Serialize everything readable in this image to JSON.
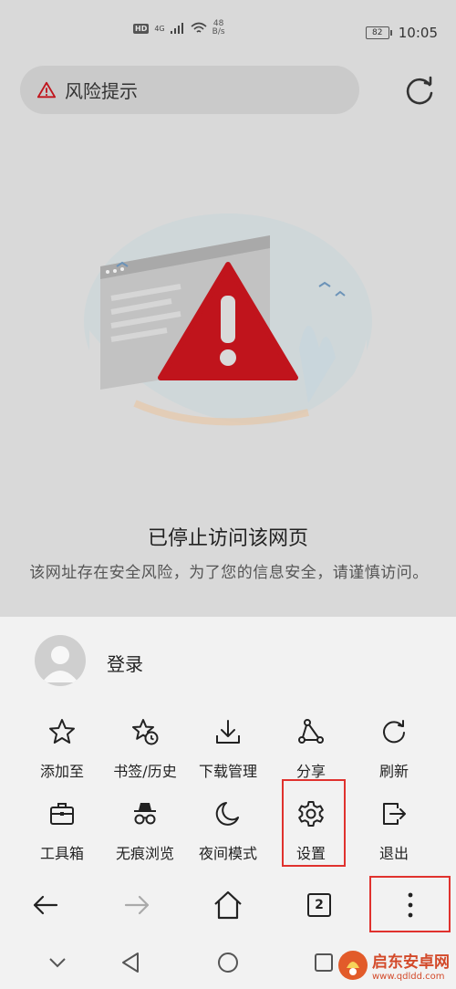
{
  "status_bar": {
    "hd_badge": "HD",
    "network_type": "4G",
    "speed_value": "48",
    "speed_unit": "B/s",
    "battery": "82",
    "time": "10:05"
  },
  "address_bar": {
    "text": "风险提示",
    "warning_icon": "warning-triangle-icon",
    "reload_icon": "reload-icon"
  },
  "error_page": {
    "title": "已停止访问该网页",
    "description": "该网址存在安全风险，为了您的信息安全，请谨慎访问。"
  },
  "menu": {
    "login_label": "登录",
    "items": [
      {
        "label": "添加至",
        "icon": "star-icon"
      },
      {
        "label": "书签/历史",
        "icon": "bookmark-history-icon"
      },
      {
        "label": "下载管理",
        "icon": "download-icon"
      },
      {
        "label": "分享",
        "icon": "share-icon"
      },
      {
        "label": "刷新",
        "icon": "refresh-icon"
      },
      {
        "label": "工具箱",
        "icon": "toolbox-icon"
      },
      {
        "label": "无痕浏览",
        "icon": "incognito-icon"
      },
      {
        "label": "夜间模式",
        "icon": "moon-icon"
      },
      {
        "label": "设置",
        "icon": "gear-icon"
      },
      {
        "label": "退出",
        "icon": "exit-icon"
      }
    ]
  },
  "toolbar": {
    "tabs_count": "2",
    "buttons": [
      "back-arrow-icon",
      "forward-arrow-icon",
      "home-icon",
      "tabs-icon",
      "more-vertical-icon"
    ]
  },
  "watermark": {
    "name": "启东安卓网",
    "url": "www.qdldd.com"
  },
  "colors": {
    "highlight": "#e0322e",
    "warning_red": "#c0141c",
    "sheet_bg": "#f2f2f2",
    "page_bg": "#d9d9d9"
  }
}
